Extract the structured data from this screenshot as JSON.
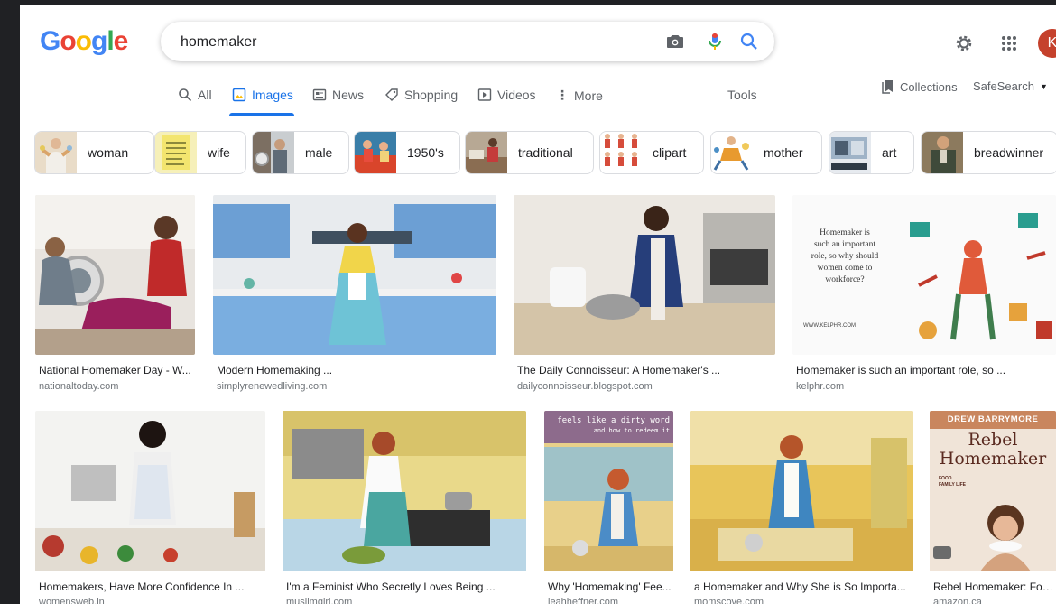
{
  "logo": "Google",
  "search": {
    "query": "homemaker"
  },
  "header": {
    "avatar_letter": "K"
  },
  "tabs": [
    {
      "label": "All"
    },
    {
      "label": "Images"
    },
    {
      "label": "News"
    },
    {
      "label": "Shopping"
    },
    {
      "label": "Videos"
    },
    {
      "label": "More"
    }
  ],
  "tools_label": "Tools",
  "collections_label": "Collections",
  "safesearch_label": "SafeSearch",
  "chips": [
    "woman",
    "wife",
    "male",
    "1950's",
    "traditional",
    "clipart",
    "mother",
    "art",
    "breadwinner"
  ],
  "results": [
    {
      "title": "National Homemaker Day - W...",
      "site": "nationaltoday.com"
    },
    {
      "title": "Modern Homemaking ...",
      "site": "simplyrenewedliving.com"
    },
    {
      "title": "The Daily Connoisseur: A Homemaker's ...",
      "site": "dailyconnoisseur.blogspot.com"
    },
    {
      "title": "Homemaker is such an important role, so ...",
      "site": "kelphr.com"
    },
    {
      "title": "Homemakers, Have More Confidence In ...",
      "site": "womensweb.in"
    },
    {
      "title": "I'm a Feminist Who Secretly Loves Being ...",
      "site": "muslimgirl.com"
    },
    {
      "title": "Why 'Homemaking' Fee...",
      "site": "leahheffner.com"
    },
    {
      "title": "a Homemaker and Why She is So Importa...",
      "site": "momscove.com"
    },
    {
      "title": "Rebel Homemaker: Foo...",
      "site": "amazon.ca"
    }
  ],
  "image_text": {
    "kelphr_quote": [
      "Homemaker is",
      "such an important",
      "role, so why should",
      "women come to",
      "workforce?"
    ],
    "kelphr_url": "WWW.KELPHR.COM",
    "leah_line1": "feels like a dirty word",
    "leah_line2": "and how to redeem it",
    "book_author": "DREW BARRYMORE",
    "book_title_1": "Rebel",
    "book_title_2": "Homemaker",
    "book_subtitle": "FOOD FAMILY LIFE"
  },
  "colors": {
    "accent": "#1a73e8",
    "background": "#202124",
    "avatar": "#c5412c"
  }
}
